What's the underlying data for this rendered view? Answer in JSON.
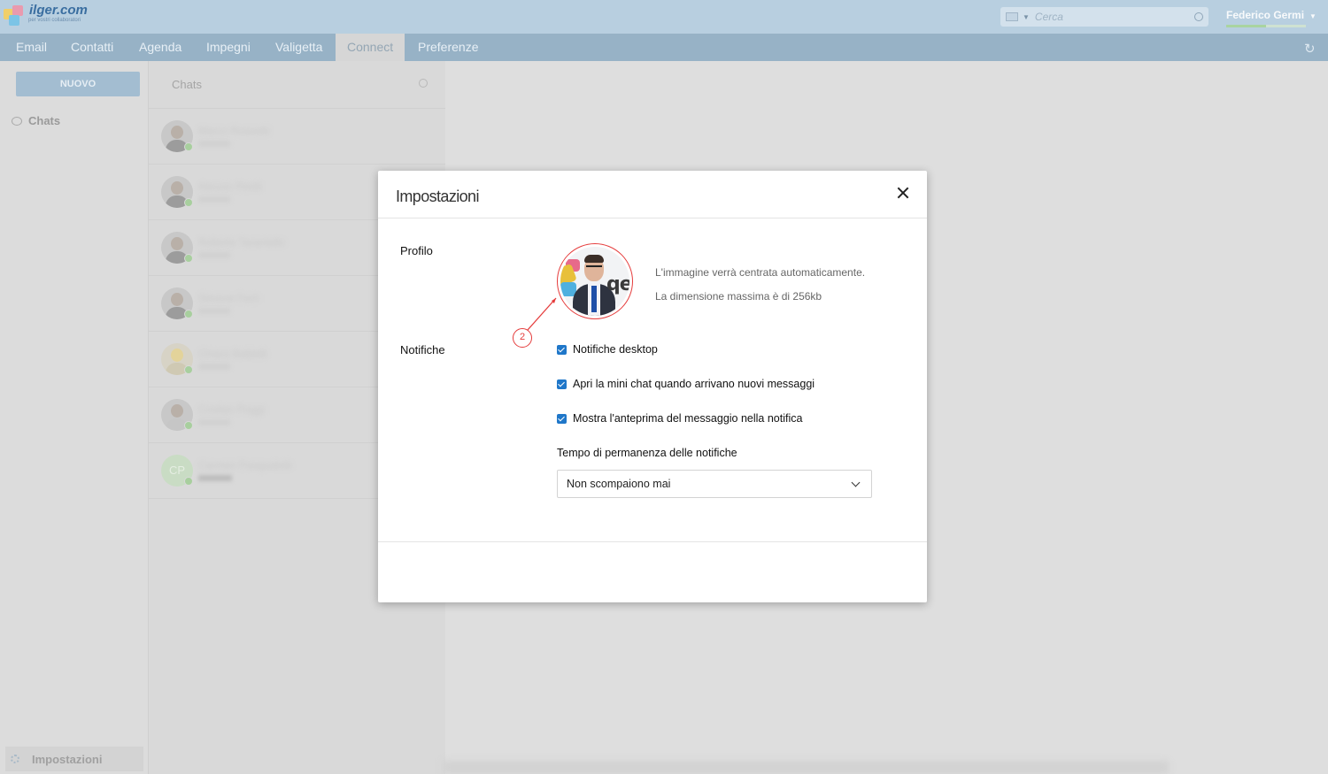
{
  "brand": {
    "name": "ilger.com",
    "tagline": "per vostri collaboratori"
  },
  "header": {
    "search_placeholder": "Cerca",
    "user_name": "Federico Germi"
  },
  "nav": {
    "tabs": [
      "Email",
      "Contatti",
      "Agenda",
      "Impegni",
      "Valigetta",
      "Connect",
      "Preferenze"
    ],
    "active": "Connect"
  },
  "sidebar": {
    "new_button": "NUOVO",
    "chats_label": "Chats",
    "settings_label": "Impostazioni"
  },
  "chatlist": {
    "title": "Chats",
    "items": [
      {
        "name": "Marco Rossetti",
        "initials": ""
      },
      {
        "name": "Alessio Pirelli",
        "initials": ""
      },
      {
        "name": "Roberto Tarantello",
        "initials": ""
      },
      {
        "name": "Simone Ferri",
        "initials": ""
      },
      {
        "name": "Chiara Baldelli",
        "initials": ""
      },
      {
        "name": "Cristian Poggi",
        "initials": ""
      },
      {
        "name": "Carmen Pasqualetti",
        "initials": "CP"
      }
    ]
  },
  "modal": {
    "title": "Impostazioni",
    "profile_label": "Profilo",
    "profile_hint_1": "L'immagine verrà centrata automaticamente.",
    "profile_hint_2": "La dimensione massima è di 256kb",
    "annotation_number": "2",
    "notifications_label": "Notifiche",
    "checkboxes": [
      {
        "label": "Notifiche desktop",
        "checked": true
      },
      {
        "label": "Apri la mini chat quando arrivano nuovi messaggi",
        "checked": true
      },
      {
        "label": "Mostra l'anteprima del messaggio nella notifica",
        "checked": true
      }
    ],
    "duration_label": "Tempo di permanenza delle notifiche",
    "duration_value": "Non scompaiono mai"
  },
  "colors": {
    "accent": "#1f77c9",
    "annotation": "#e53b3b",
    "topbar": "#b8cfe0",
    "navbar": "#97b2c6"
  }
}
